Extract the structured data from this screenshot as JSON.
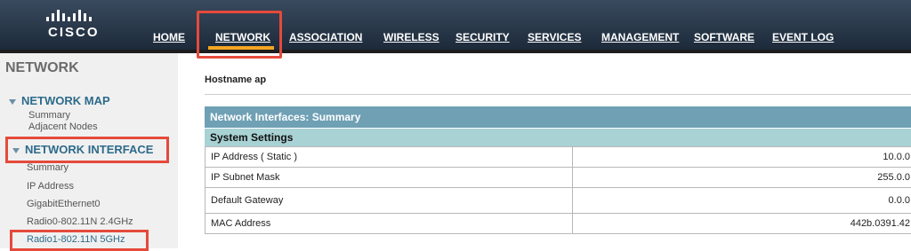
{
  "brand": {
    "name": "CISCO",
    "bars": [
      8,
      12,
      14,
      12,
      8,
      12,
      14,
      12,
      8
    ]
  },
  "nav": {
    "items": [
      "HOME",
      "NETWORK",
      "ASSOCIATION",
      "WIRELESS",
      "SECURITY",
      "SERVICES",
      "MANAGEMENT",
      "SOFTWARE",
      "EVENT LOG"
    ],
    "active": "NETWORK"
  },
  "sidebar": {
    "title": "NETWORK",
    "network_map": {
      "label": "NETWORK MAP",
      "items": [
        "Summary",
        "Adjacent Nodes"
      ]
    },
    "network_interface": {
      "label": "NETWORK INTERFACE",
      "items": [
        "Summary",
        "IP Address",
        "GigabitEthernet0",
        "Radio0-802.11N 2.4GHz",
        "Radio1-802.11N 5GHz"
      ]
    }
  },
  "main": {
    "hostname_label": "Hostname  ap",
    "panel_title": "Network Interfaces: Summary",
    "section_title": "System Settings",
    "rows": [
      {
        "label": "IP Address ( Static )",
        "value": "10.0.0"
      },
      {
        "label": "IP Subnet Mask",
        "value": "255.0.0"
      },
      {
        "label": "Default Gateway",
        "value": "0.0.0"
      },
      {
        "label": "MAC Address",
        "value": "442b.0391.42"
      }
    ]
  },
  "colors": {
    "highlight": "#e54a3b",
    "active_underline": "#f5a623",
    "panel_head": "#6fa0b4",
    "section_head": "#a8d2d4"
  }
}
